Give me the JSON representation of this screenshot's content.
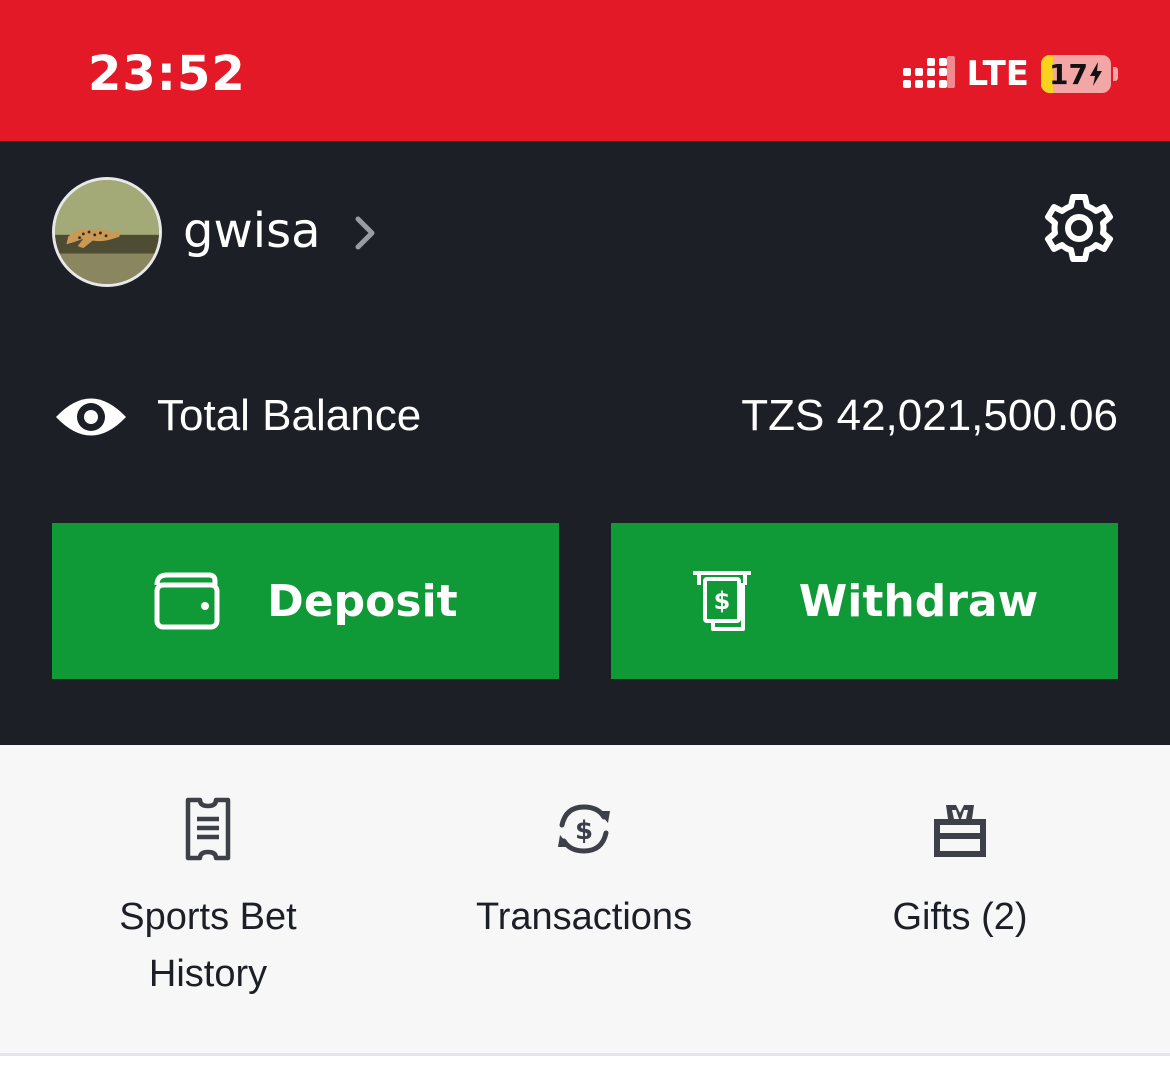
{
  "status_bar": {
    "time": "23:52",
    "network": "LTE",
    "battery_level": "17",
    "battery_fraction": 0.17,
    "charging": true,
    "background_color": "#e31927"
  },
  "profile": {
    "username": "gwisa",
    "avatar_icon": "cheetah-avatar",
    "settings_icon": "gear-icon"
  },
  "balance": {
    "label": "Total Balance",
    "value": "TZS 42,021,500.06",
    "visibility_icon": "eye-icon"
  },
  "actions": {
    "deposit_label": "Deposit",
    "withdraw_label": "Withdraw",
    "deposit_icon": "wallet-icon",
    "withdraw_icon": "atm-cash-icon",
    "button_color": "#109937"
  },
  "shortcuts": [
    {
      "label": "Sports Bet History",
      "icon": "ticket-icon"
    },
    {
      "label": "Transactions",
      "icon": "money-exchange-icon"
    },
    {
      "label": "Gifts (2)",
      "icon": "gift-icon"
    }
  ],
  "colors": {
    "panel_background": "#1c1f26",
    "page_background": "#f7f7f7",
    "text_dark": "#1c1f26"
  }
}
